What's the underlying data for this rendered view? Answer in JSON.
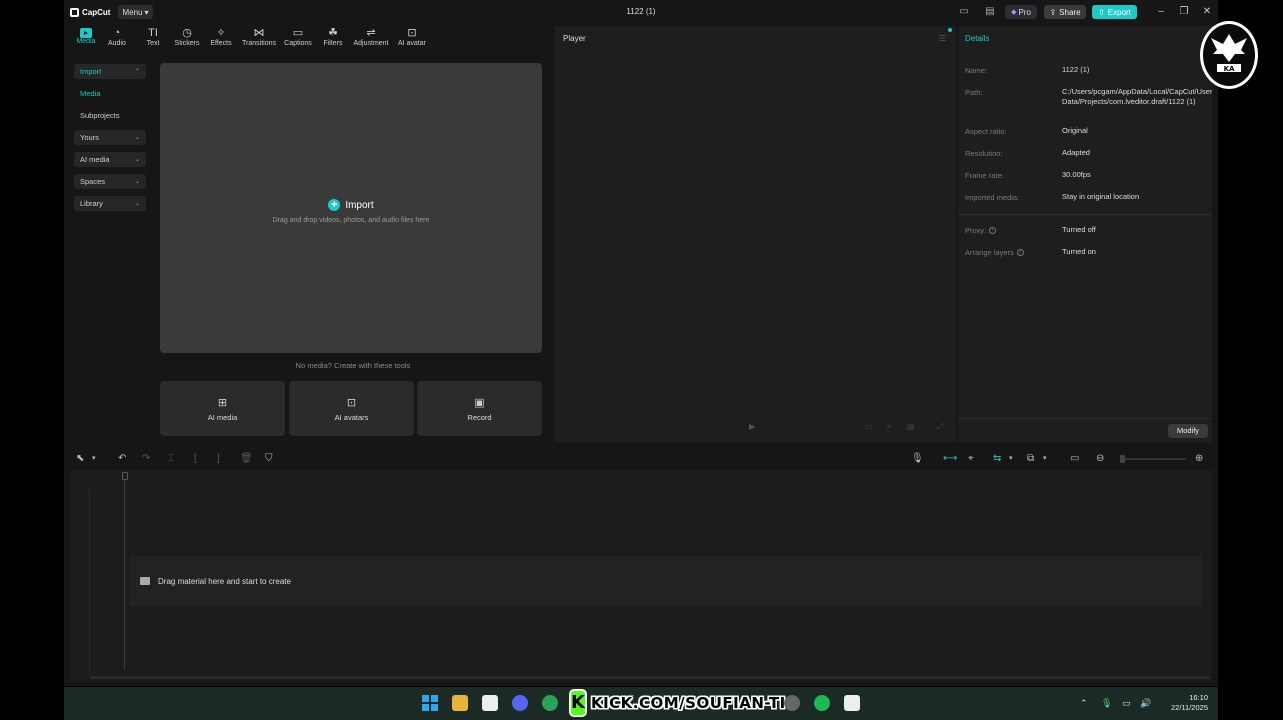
{
  "window": {
    "app_name": "CapCut",
    "menu_label": "Menu",
    "project_title": "1122 (1)",
    "pro_label": "Pro",
    "share_label": "Share",
    "export_label": "Export"
  },
  "toolbar": {
    "items": [
      {
        "label": "Media",
        "icon": "media-icon",
        "active": true
      },
      {
        "label": "Audio",
        "icon": "audio-icon"
      },
      {
        "label": "Text",
        "icon": "text-icon"
      },
      {
        "label": "Stickers",
        "icon": "stickers-icon"
      },
      {
        "label": "Effects",
        "icon": "effects-icon"
      },
      {
        "label": "Transitions",
        "icon": "transitions-icon"
      },
      {
        "label": "Captions",
        "icon": "captions-icon"
      },
      {
        "label": "Filters",
        "icon": "filters-icon"
      },
      {
        "label": "Adjustment",
        "icon": "adjustment-icon"
      },
      {
        "label": "AI avatar",
        "icon": "ai-avatar-icon"
      }
    ]
  },
  "sidebar": {
    "items": [
      {
        "label": "Import"
      },
      {
        "label": "Media"
      },
      {
        "label": "Subprojects"
      },
      {
        "label": "Yours"
      },
      {
        "label": "AI media"
      },
      {
        "label": "Spaces"
      },
      {
        "label": "Library"
      }
    ]
  },
  "media": {
    "import_label": "Import",
    "import_hint": "Drag and drop videos, photos, and audio files here",
    "no_media_text": "No media? Create with these tools",
    "tools": [
      {
        "label": "AI media",
        "icon": "ai-media-icon"
      },
      {
        "label": "AI avatars",
        "icon": "ai-avatars-icon"
      },
      {
        "label": "Record",
        "icon": "record-icon"
      }
    ]
  },
  "player": {
    "title": "Player"
  },
  "details": {
    "title": "Details",
    "rows": [
      {
        "label": "Name:",
        "value": "1122 (1)"
      },
      {
        "label": "Path:",
        "value": "C:/Users/pcgam/AppData/Local/CapCut/User Data/Projects/com.lveditor.draft/1122 (1)"
      },
      {
        "label": "Aspect ratio:",
        "value": "Original"
      },
      {
        "label": "Resolution:",
        "value": "Adapted"
      },
      {
        "label": "Frame rate:",
        "value": "30.00fps"
      },
      {
        "label": "Imported media:",
        "value": "Stay in original location"
      },
      {
        "label": "Proxy:",
        "value": "Turned off"
      },
      {
        "label": "Arrange layers",
        "value": "Turned on"
      }
    ],
    "modify_label": "Modify"
  },
  "timeline": {
    "drop_hint": "Drag material here and start to create"
  },
  "taskbar": {
    "overlay_text": "KICK.COM/SOUFIAN-TI",
    "time": "16:10",
    "date": "22/11/2025"
  },
  "colors": {
    "accent": "#1fc9c8",
    "background": "#161616",
    "panel": "#1e1e1e",
    "import_zone": "#3a3a3a",
    "kick_green": "#53fc18"
  }
}
